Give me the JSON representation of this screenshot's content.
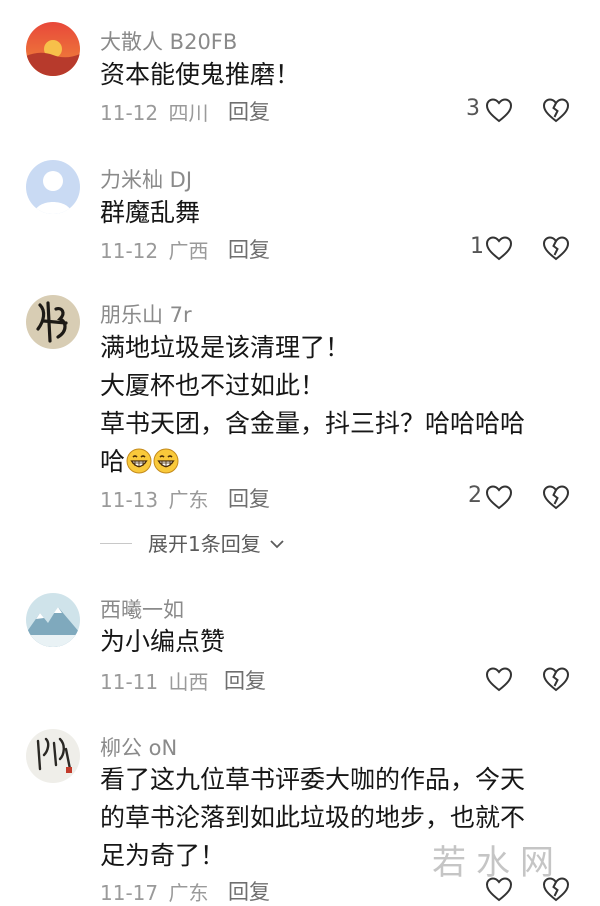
{
  "comments": [
    {
      "username": "大散人 B20FB",
      "lines": [
        "资本能使鬼推磨！"
      ],
      "date": "11-12",
      "location": "四川",
      "reply_label": "回复",
      "like_count": "3"
    },
    {
      "username": "力米杣 DJ",
      "lines": [
        "群魔乱舞"
      ],
      "date": "11-12",
      "location": "广西",
      "reply_label": "回复",
      "like_count": "1"
    },
    {
      "username": "朋乐山 7r",
      "lines": [
        "满地垃圾是该清理了！",
        "大厦杯也不过如此！",
        "草书天团，含金量，抖三抖？哈哈哈哈",
        "哈"
      ],
      "date": "11-13",
      "location": "广东",
      "reply_label": "回复",
      "like_count": "2",
      "expand_label": "展开1条回复"
    },
    {
      "username": "西曦一如",
      "lines": [
        "为小编点赞"
      ],
      "date": "11-11",
      "location": "山西",
      "reply_label": "回复",
      "like_count": ""
    },
    {
      "username": "柳公 oN",
      "lines": [
        "看了这九位草书评委大咖的作品，今天",
        "的草书沦落到如此垃圾的地步，也就不",
        "足为奇了！"
      ],
      "date": "11-17",
      "location": "广东",
      "reply_label": "回复",
      "like_count": ""
    }
  ],
  "icons": {
    "like": "heart-outline-icon",
    "dislike": "broken-heart-icon",
    "expand": "chevron-down-icon",
    "emoji": "grinning-face-emoji"
  },
  "watermark": "若水网",
  "colors": {
    "username": "#8a8a8a",
    "text": "#161616",
    "meta": "#9a9a9a"
  }
}
